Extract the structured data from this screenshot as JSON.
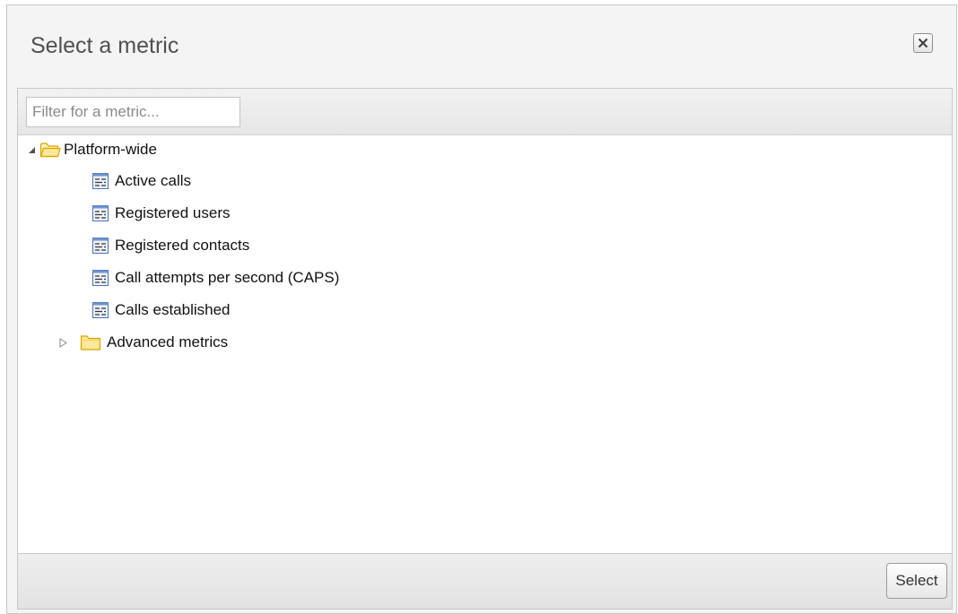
{
  "dialog": {
    "title": "Select a metric",
    "close_icon": "close-icon"
  },
  "filter": {
    "placeholder": "Filter for a metric...",
    "value": ""
  },
  "tree": {
    "root": {
      "label": "Platform-wide",
      "expanded": true,
      "icon": "folder-open-icon",
      "children": [
        {
          "label": "Active calls",
          "icon": "metric-icon"
        },
        {
          "label": "Registered users",
          "icon": "metric-icon"
        },
        {
          "label": "Registered contacts",
          "icon": "metric-icon"
        },
        {
          "label": "Call attempts per second (CAPS)",
          "icon": "metric-icon"
        },
        {
          "label": "Calls established",
          "icon": "metric-icon"
        },
        {
          "label": "Advanced metrics",
          "icon": "folder-icon",
          "expanded": false
        }
      ]
    }
  },
  "footer": {
    "select_label": "Select"
  },
  "colors": {
    "folder_fill": "#fde79a",
    "folder_stroke": "#d9a400",
    "metric_fill": "#dde9fb",
    "metric_stroke": "#4a73b5"
  }
}
